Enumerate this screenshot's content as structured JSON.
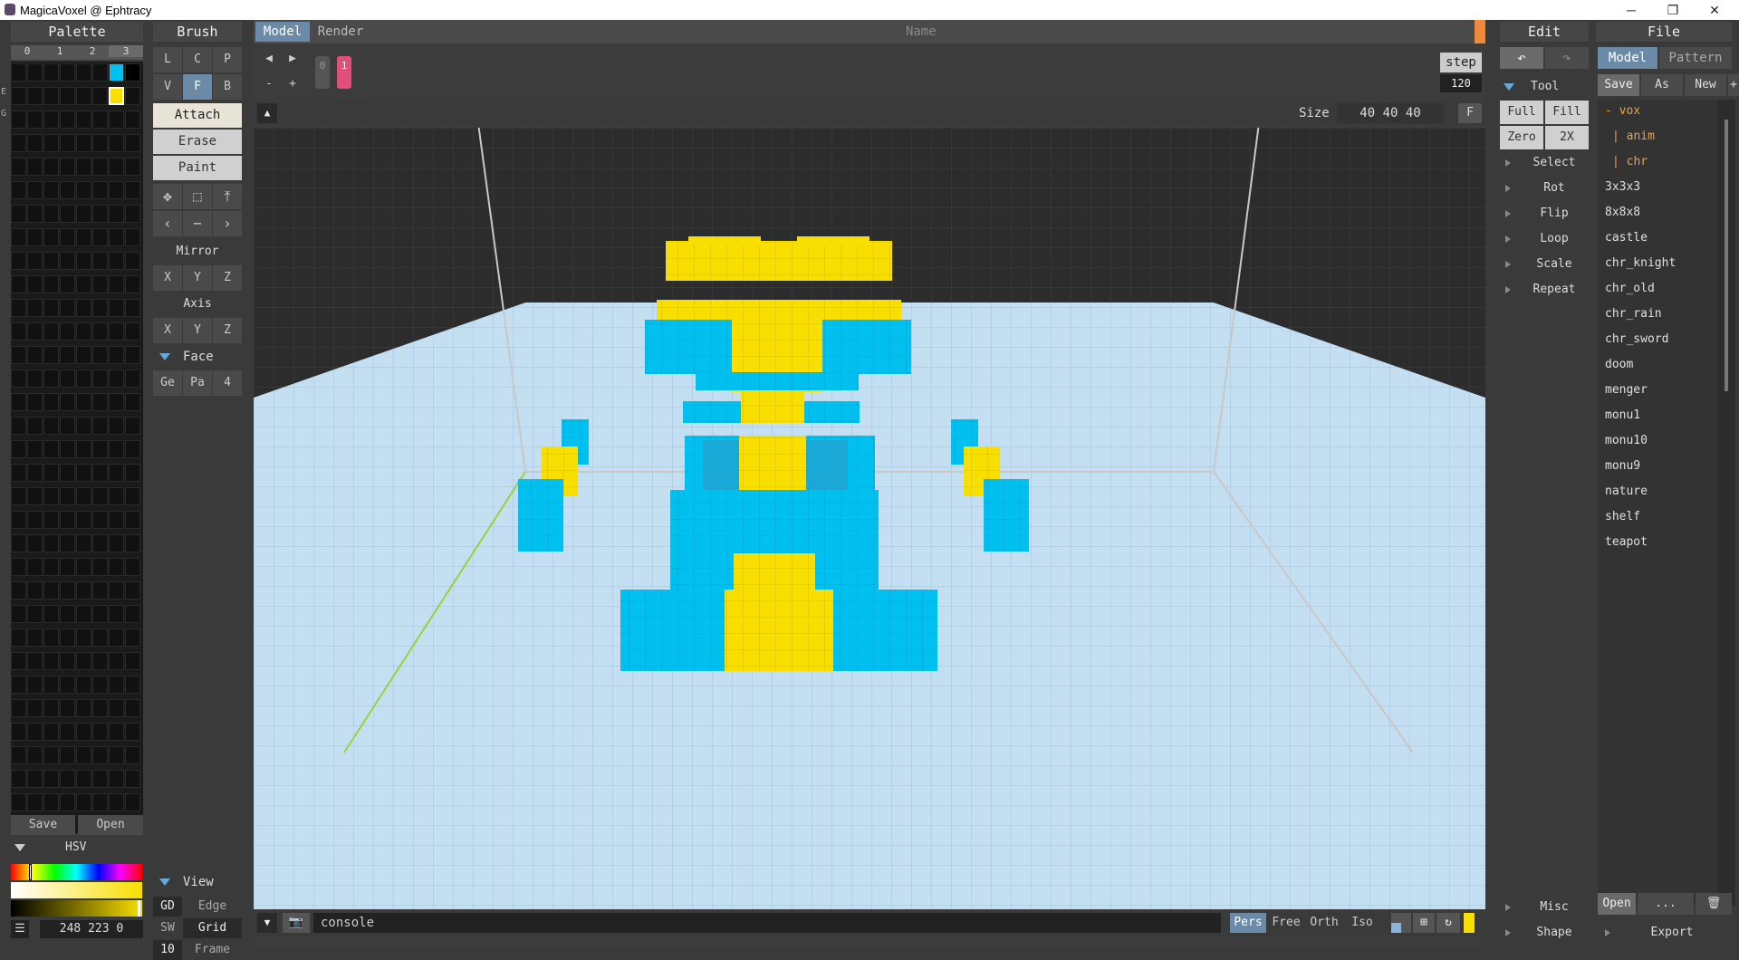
{
  "window": {
    "title": "MagicaVoxel @ Ephtracy",
    "minimize": "─",
    "maximize": "❐",
    "close": "✕"
  },
  "palette": {
    "title": "Palette",
    "tabs": [
      "0",
      "1",
      "2",
      "3"
    ],
    "side_labels": [
      "E",
      "G"
    ],
    "save": "Save",
    "open": "Open",
    "hsv_label": "HSV",
    "color_value": "248 223 0",
    "menu_icon": "☰",
    "selected_color": "#f8df00",
    "second_color": "#00c0f0"
  },
  "brush": {
    "title": "Brush",
    "row1": [
      "L",
      "C",
      "P"
    ],
    "row2": [
      "V",
      "F",
      "B"
    ],
    "modes": [
      "Attach",
      "Erase",
      "Paint"
    ],
    "mirror": "Mirror",
    "mirror_axes": [
      "X",
      "Y",
      "Z"
    ],
    "axis": "Axis",
    "axis_axes": [
      "X",
      "Y",
      "Z"
    ],
    "face": "Face",
    "face_row": [
      "Ge",
      "Pa",
      "4"
    ],
    "view": "View",
    "view_rows": [
      {
        "a": "GD",
        "b": "Edge"
      },
      {
        "a": "SW",
        "b": "Grid"
      },
      {
        "a": "10",
        "b": "Frame"
      }
    ]
  },
  "viewport": {
    "tabs": [
      "Model",
      "Render"
    ],
    "name_label": "Name",
    "frames": [
      "0",
      "1"
    ],
    "step_label": "step",
    "step_value": "120",
    "size_label": "Size",
    "size_value": "40 40 40",
    "f_button": "F",
    "console": "console",
    "camera_modes": [
      "Pers",
      "Free",
      "Orth",
      "Iso"
    ]
  },
  "edit": {
    "title": "Edit",
    "tool": "Tool",
    "tool_grid": [
      "Full",
      "Fill",
      "Zero",
      "2X"
    ],
    "items": [
      "Select",
      "Rot",
      "Flip",
      "Loop",
      "Scale",
      "Repeat"
    ],
    "bottom": [
      "Misc",
      "Shape"
    ]
  },
  "file": {
    "title": "File",
    "tabs": [
      "Model",
      "Pattern"
    ],
    "actions": [
      "Save",
      "As",
      "New",
      "+"
    ],
    "tree": [
      "- vox",
      "| anim",
      "| chr"
    ],
    "files": [
      "3x3x3",
      "8x8x8",
      "castle",
      "chr_knight",
      "chr_old",
      "chr_rain",
      "chr_sword",
      "doom",
      "menger",
      "monu1",
      "monu10",
      "monu9",
      "nature",
      "shelf",
      "teapot"
    ],
    "bottom": [
      "Open",
      "...",
      "🗑"
    ],
    "export": "Export"
  },
  "colors": {
    "accent": "#6a9ac4",
    "yellow": "#f8df00",
    "cyan": "#00c0f0",
    "pink": "#e0507a",
    "orange": "#f08a3a"
  }
}
